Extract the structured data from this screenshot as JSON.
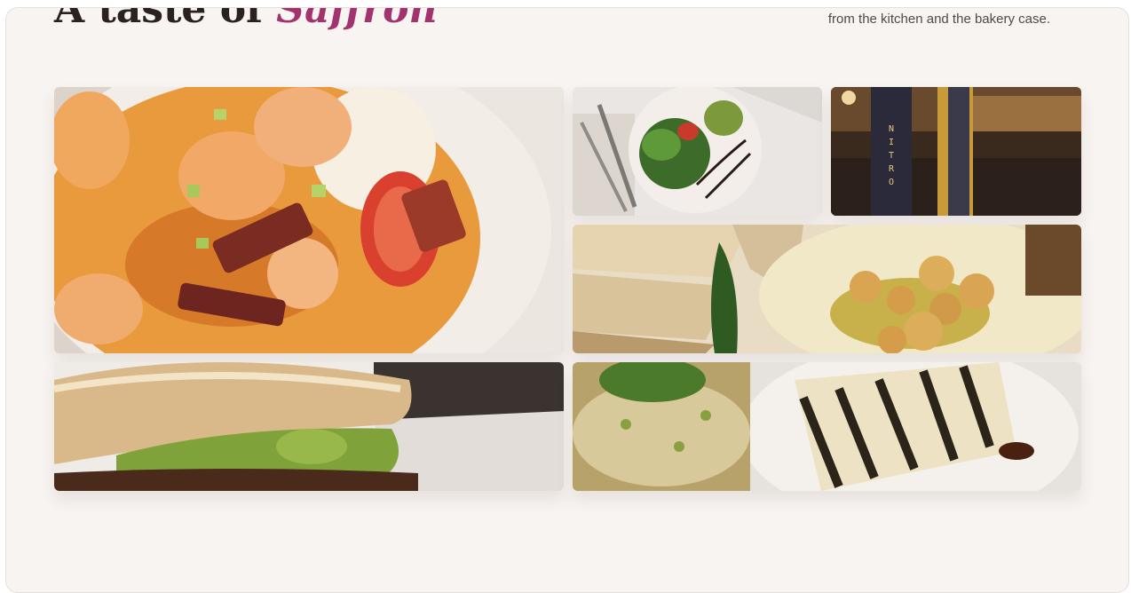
{
  "header": {
    "title_main": "A taste of ",
    "title_accent": "Saffron",
    "subtitle": "from the kitchen and the bakery case."
  },
  "gallery": {
    "tiles": [
      {
        "id": "shrimp-and-grits",
        "icon": "shrimp-grits-photo"
      },
      {
        "id": "salad-plate",
        "icon": "salad-photo"
      },
      {
        "id": "nitro-tap",
        "icon": "nitro-tap-photo"
      },
      {
        "id": "hummus-pita",
        "icon": "hummus-photo"
      },
      {
        "id": "avocado-sandwich",
        "icon": "sandwich-photo"
      },
      {
        "id": "grilled-halloumi",
        "icon": "halloumi-photo"
      }
    ],
    "nitro_label": "NITRO"
  },
  "colors": {
    "accent": "#a2336e",
    "background": "#f8f4f1",
    "text": "#2b2220"
  }
}
